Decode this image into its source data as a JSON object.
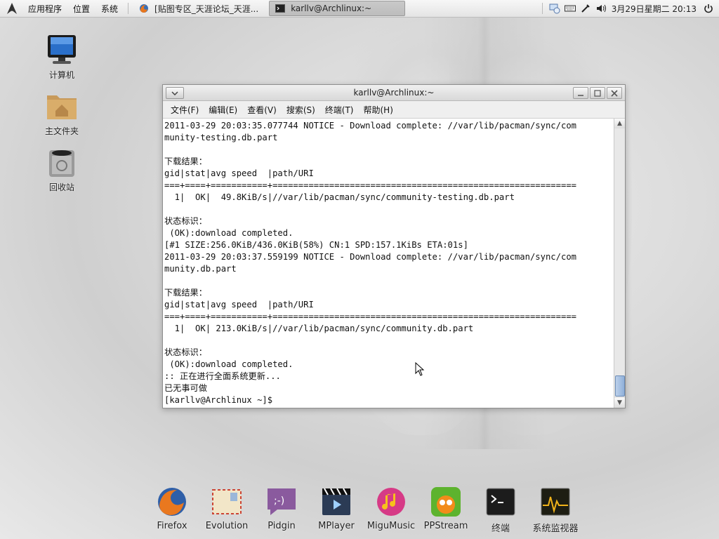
{
  "top_panel": {
    "menus": [
      "应用程序",
      "位置",
      "系统"
    ],
    "tasks": [
      {
        "label": "[贴图专区_天涯论坛_天涯...",
        "icon": "firefox-icon",
        "active": false
      },
      {
        "label": "karllv@Archlinux:~",
        "icon": "terminal-icon",
        "active": true
      }
    ],
    "tray_icons": [
      "network-icon",
      "keyboard-icon",
      "volume-icon",
      "bluetooth-icon"
    ],
    "clock": "3月29日星期二 20:13",
    "power_icon": "power-icon"
  },
  "desktop_icons": [
    {
      "label": "计算机",
      "icon": "computer-icon"
    },
    {
      "label": "主文件夹",
      "icon": "home-folder-icon"
    },
    {
      "label": "回收站",
      "icon": "trash-icon"
    }
  ],
  "terminal": {
    "title": "karllv@Archlinux:~",
    "menu": [
      "文件(F)",
      "编辑(E)",
      "查看(V)",
      "搜索(S)",
      "终端(T)",
      "帮助(H)"
    ],
    "lines": [
      "2011-03-29 20:03:35.077744 NOTICE - Download complete: //var/lib/pacman/sync/com",
      "munity-testing.db.part",
      "",
      "下载结果：",
      "gid|stat|avg speed  |path/URI",
      "===+====+===========+===========================================================",
      "  1|  OK|  49.8KiB/s|//var/lib/pacman/sync/community-testing.db.part",
      "",
      "状态标识：",
      " (OK):download completed.",
      "[#1 SIZE:256.0KiB/436.0KiB(58%) CN:1 SPD:157.1KiBs ETA:01s]",
      "2011-03-29 20:03:37.559199 NOTICE - Download complete: //var/lib/pacman/sync/com",
      "munity.db.part",
      "",
      "下载结果：",
      "gid|stat|avg speed  |path/URI",
      "===+====+===========+===========================================================",
      "  1|  OK| 213.0KiB/s|//var/lib/pacman/sync/community.db.part",
      "",
      "状态标识：",
      " (OK):download completed.",
      ":: 正在进行全面系统更新...",
      "已无事可做",
      "[karllv@Archlinux ~]$"
    ]
  },
  "dock": [
    {
      "label": "Firefox",
      "icon": "firefox-icon"
    },
    {
      "label": "Evolution",
      "icon": "evolution-icon"
    },
    {
      "label": "Pidgin",
      "icon": "pidgin-icon"
    },
    {
      "label": "MPlayer",
      "icon": "mplayer-icon"
    },
    {
      "label": "MiguMusic",
      "icon": "music-icon"
    },
    {
      "label": "PPStream",
      "icon": "ppstream-icon"
    },
    {
      "label": "终端",
      "icon": "terminal-icon"
    },
    {
      "label": "系统监视器",
      "icon": "system-monitor-icon"
    }
  ]
}
